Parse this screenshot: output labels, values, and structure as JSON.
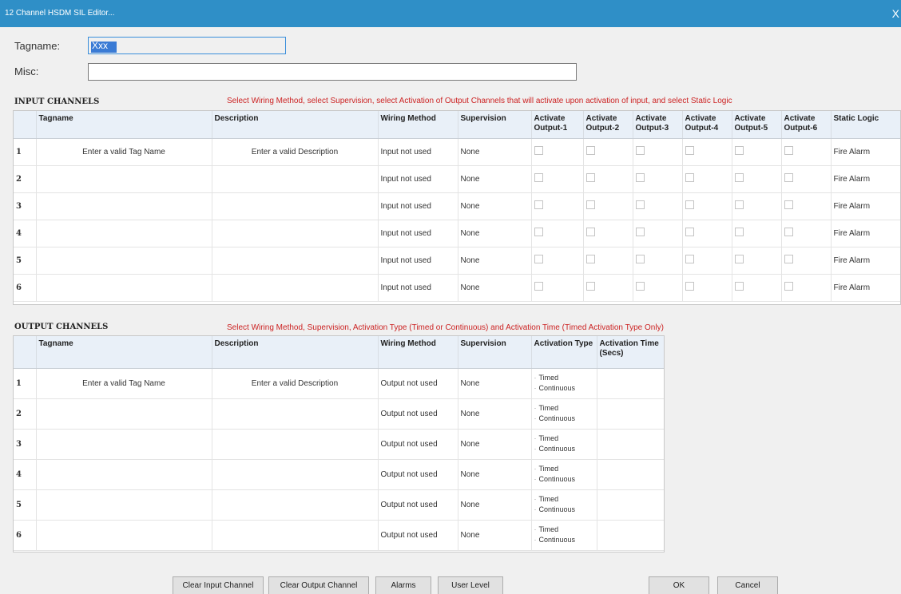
{
  "window": {
    "title": "12 Channel HSDM SIL Editor...",
    "close_glyph": "X"
  },
  "header": {
    "tagname_label": "Tagname:",
    "tagname_value": "Xxx",
    "misc_label": "Misc:",
    "misc_value": ""
  },
  "input_channels": {
    "title": "INPUT CHANNELS",
    "instruction": "Select Wiring Method, select Supervision, select Activation of Output Channels that will activate upon activation of input, and select Static Logic",
    "columns": [
      "",
      "Tagname",
      "Description",
      "Wiring Method",
      "Supervision",
      "Activate Output-1",
      "Activate Output-2",
      "Activate Output-3",
      "Activate Output-4",
      "Activate Output-5",
      "Activate Output-6",
      "Static Logic"
    ],
    "rows": [
      {
        "num": "1",
        "tagname": "Enter a valid Tag Name",
        "description": "Enter a valid Description",
        "wiring": "Input not used",
        "supervision": "None",
        "static_logic": "Fire Alarm"
      },
      {
        "num": "2",
        "tagname": "",
        "description": "",
        "wiring": "Input not used",
        "supervision": "None",
        "static_logic": "Fire Alarm"
      },
      {
        "num": "3",
        "tagname": "",
        "description": "",
        "wiring": "Input not used",
        "supervision": "None",
        "static_logic": "Fire Alarm"
      },
      {
        "num": "4",
        "tagname": "",
        "description": "",
        "wiring": "Input not used",
        "supervision": "None",
        "static_logic": "Fire Alarm"
      },
      {
        "num": "5",
        "tagname": "",
        "description": "",
        "wiring": "Input not used",
        "supervision": "None",
        "static_logic": "Fire Alarm"
      },
      {
        "num": "6",
        "tagname": "",
        "description": "",
        "wiring": "Input not used",
        "supervision": "None",
        "static_logic": "Fire Alarm"
      }
    ]
  },
  "output_channels": {
    "title": "OUTPUT CHANNELS",
    "instruction": "Select Wiring Method, Supervision, Activation Type (Timed or Continuous) and Activation Time (Timed Activation Type Only)",
    "columns": [
      "",
      "Tagname",
      "Description",
      "Wiring Method",
      "Supervision",
      "Activation Type",
      "Activation Time (Secs)"
    ],
    "rows": [
      {
        "num": "1",
        "tagname": "Enter a valid Tag Name",
        "description": "Enter a valid Description",
        "wiring": "Output not used",
        "supervision": "None",
        "timed": "Timed",
        "continuous": "Continuous",
        "time": ""
      },
      {
        "num": "2",
        "tagname": "",
        "description": "",
        "wiring": "Output not used",
        "supervision": "None",
        "timed": "Timed",
        "continuous": "Continuous",
        "time": ""
      },
      {
        "num": "3",
        "tagname": "",
        "description": "",
        "wiring": "Output not used",
        "supervision": "None",
        "timed": "Timed",
        "continuous": "Continuous",
        "time": ""
      },
      {
        "num": "4",
        "tagname": "",
        "description": "",
        "wiring": "Output not used",
        "supervision": "None",
        "timed": "Timed",
        "continuous": "Continuous",
        "time": ""
      },
      {
        "num": "5",
        "tagname": "",
        "description": "",
        "wiring": "Output not used",
        "supervision": "None",
        "timed": "Timed",
        "continuous": "Continuous",
        "time": ""
      },
      {
        "num": "6",
        "tagname": "",
        "description": "",
        "wiring": "Output not used",
        "supervision": "None",
        "timed": "Timed",
        "continuous": "Continuous",
        "time": ""
      }
    ]
  },
  "buttons": {
    "clear_input": "Clear Input Channel",
    "clear_output": "Clear Output Channel",
    "alarms": "Alarms",
    "user_level": "User Level",
    "ok": "OK",
    "cancel": "Cancel"
  }
}
